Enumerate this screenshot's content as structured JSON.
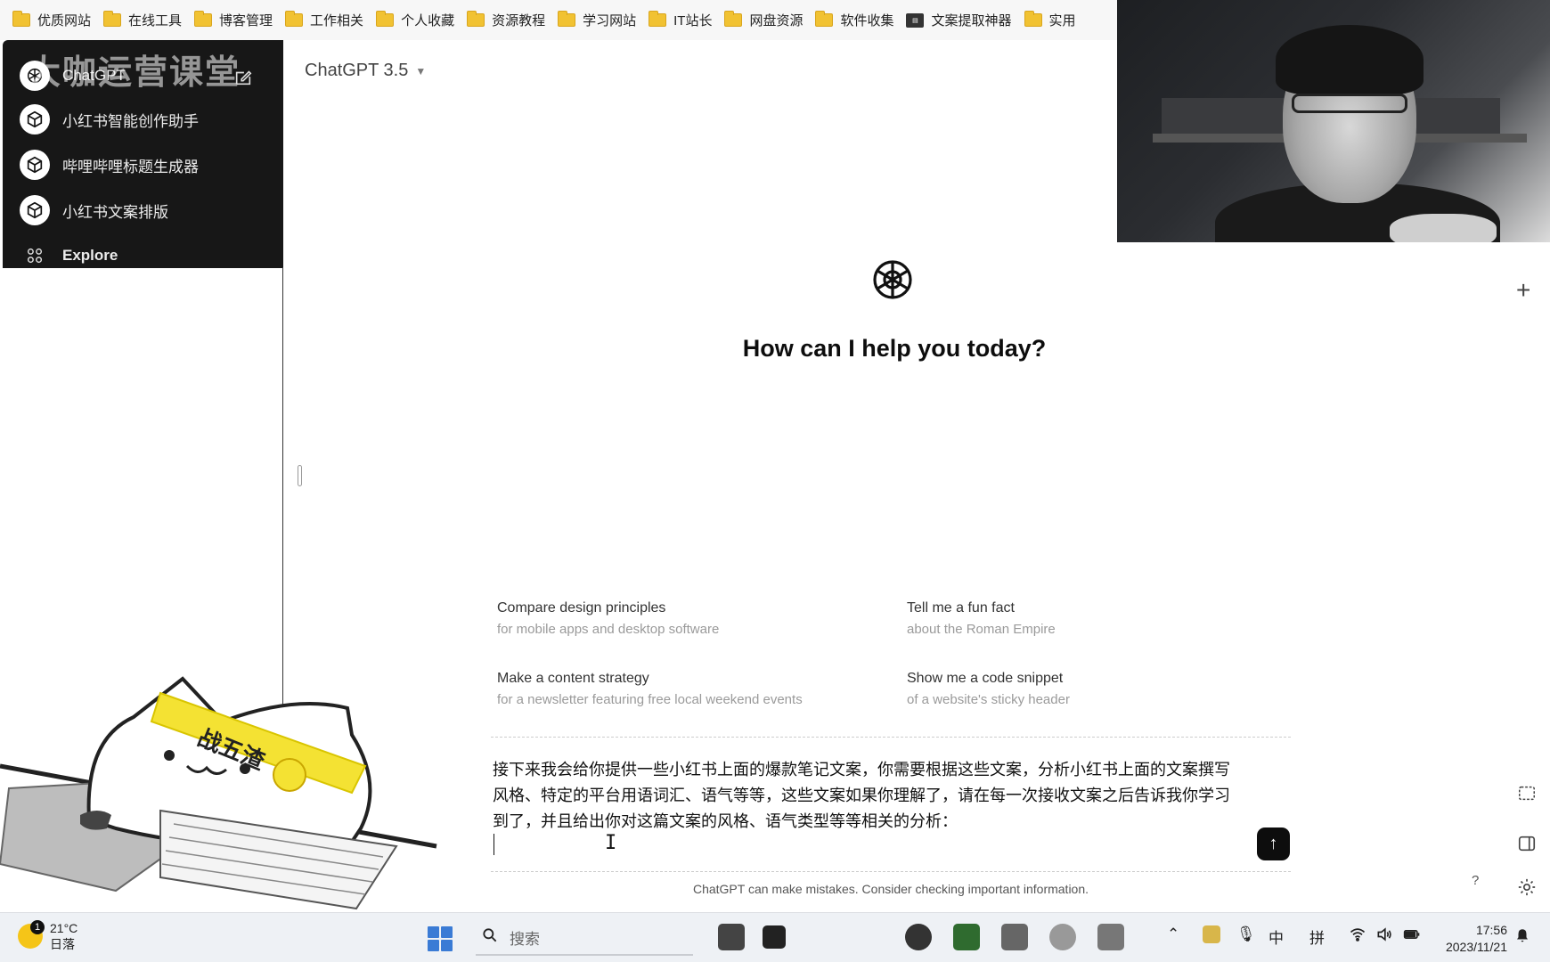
{
  "bookmarks": [
    {
      "label": "优质网站",
      "icon": "folder-icon"
    },
    {
      "label": "在线工具",
      "icon": "folder-icon"
    },
    {
      "label": "博客管理",
      "icon": "folder-icon"
    },
    {
      "label": "工作相关",
      "icon": "folder-icon"
    },
    {
      "label": "个人收藏",
      "icon": "folder-icon"
    },
    {
      "label": "资源教程",
      "icon": "folder-icon"
    },
    {
      "label": "学习网站",
      "icon": "folder-icon"
    },
    {
      "label": "IT站长",
      "icon": "folder-icon"
    },
    {
      "label": "网盘资源",
      "icon": "folder-icon"
    },
    {
      "label": "软件收集",
      "icon": "folder-icon"
    },
    {
      "label": "文案提取神器",
      "icon": "app-icon"
    },
    {
      "label": "实用",
      "icon": "folder-icon"
    }
  ],
  "watermark": "大咖运营课堂",
  "sidebar": {
    "items": [
      {
        "label": "ChatGPT"
      },
      {
        "label": "小红书智能创作助手"
      },
      {
        "label": "哔哩哔哩标题生成器"
      },
      {
        "label": "小红书文案排版"
      },
      {
        "label": "Explore"
      }
    ]
  },
  "header": {
    "model": "ChatGPT 3.5"
  },
  "hero": {
    "title": "How can I help you today?"
  },
  "suggestions": [
    {
      "title": "Compare design principles",
      "subtitle": "for mobile apps and desktop software"
    },
    {
      "title": "Tell me a fun fact",
      "subtitle": "about the Roman Empire"
    },
    {
      "title": "Make a content strategy",
      "subtitle": "for a newsletter featuring free local weekend events"
    },
    {
      "title": "Show me a code snippet",
      "subtitle": "of a website's sticky header"
    }
  ],
  "composer": {
    "text": "接下来我会给你提供一些小红书上面的爆款笔记文案，你需要根据这些文案，分析小红书上面的文案撰写风格、特定的平台用语词汇、语气等等，这些文案如果你理解了，请在每一次接收文案之后告诉我你学习到了，并且给出你对这篇文案的风格、语气类型等等相关的分析："
  },
  "disclaimer": "ChatGPT can make mistakes. Consider checking important information.",
  "help_label": "?",
  "mascot": {
    "headband": "战五渣"
  },
  "taskbar": {
    "weather_temp": "21°C",
    "weather_desc": "日落",
    "weather_badge": "1",
    "search_placeholder": "搜索",
    "ime_lang": "中",
    "ime_mode": "拼",
    "time": "17:56",
    "date": "2023/11/21"
  },
  "colors": {
    "accent": "#0d0d0d",
    "sidebar_bg": "#171717",
    "taskbar_bg": "#eef1f5"
  }
}
